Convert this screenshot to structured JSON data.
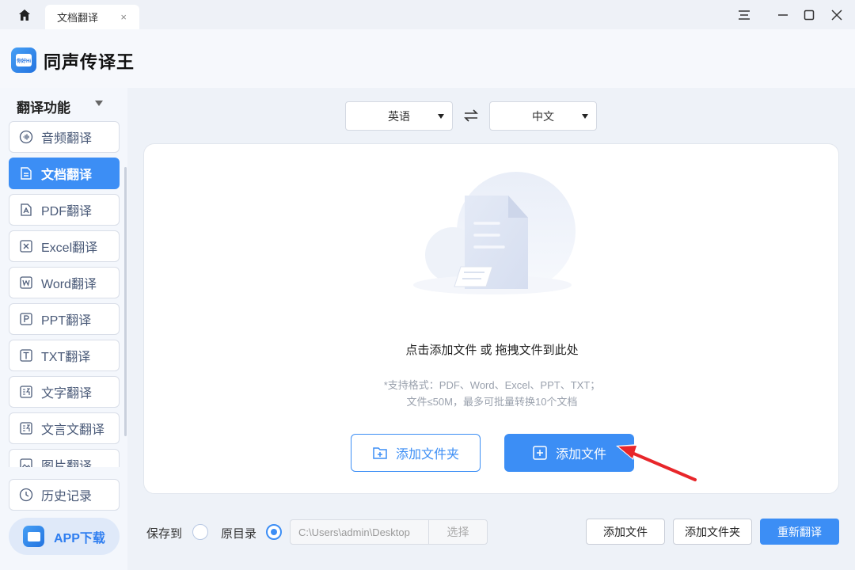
{
  "tab": {
    "title": "文档翻译",
    "close": "×"
  },
  "app": {
    "name": "同声传译王",
    "logo_text": "你好Hi"
  },
  "sidebar": {
    "heading": "翻译功能",
    "items": [
      {
        "label": "音频翻译",
        "icon": "audio-icon",
        "active": false
      },
      {
        "label": "文档翻译",
        "icon": "document-icon",
        "active": true
      },
      {
        "label": "PDF翻译",
        "icon": "pdf-icon",
        "active": false
      },
      {
        "label": "Excel翻译",
        "icon": "excel-icon",
        "active": false
      },
      {
        "label": "Word翻译",
        "icon": "word-icon",
        "active": false
      },
      {
        "label": "PPT翻译",
        "icon": "ppt-icon",
        "active": false
      },
      {
        "label": "TXT翻译",
        "icon": "txt-icon",
        "active": false
      },
      {
        "label": "文字翻译",
        "icon": "text-translate-icon",
        "active": false
      },
      {
        "label": "文言文翻译",
        "icon": "classical-chinese-icon",
        "active": false
      },
      {
        "label": "图片翻译",
        "icon": "image-icon",
        "active": false
      }
    ],
    "history": "历史记录",
    "app_download": "APP下载"
  },
  "languages": {
    "source": "英语",
    "target": "中文"
  },
  "dropzone": {
    "title": "点击添加文件 或 拖拽文件到此处",
    "hint1": "*支持格式：PDF、Word、Excel、PPT、TXT；",
    "hint2": "文件≤50M，最多可批量转换10个文档",
    "add_folder": "添加文件夹",
    "add_file": "添加文件"
  },
  "bottom": {
    "save_to": "保存到",
    "original_dir": "原目录",
    "path": "C:\\Users\\admin\\Desktop",
    "choose": "选择",
    "add_file": "添加文件",
    "add_folder": "添加文件夹",
    "retranslate": "重新翻译"
  },
  "colors": {
    "accent": "#3c8ef5",
    "arrow": "#e8262a"
  }
}
